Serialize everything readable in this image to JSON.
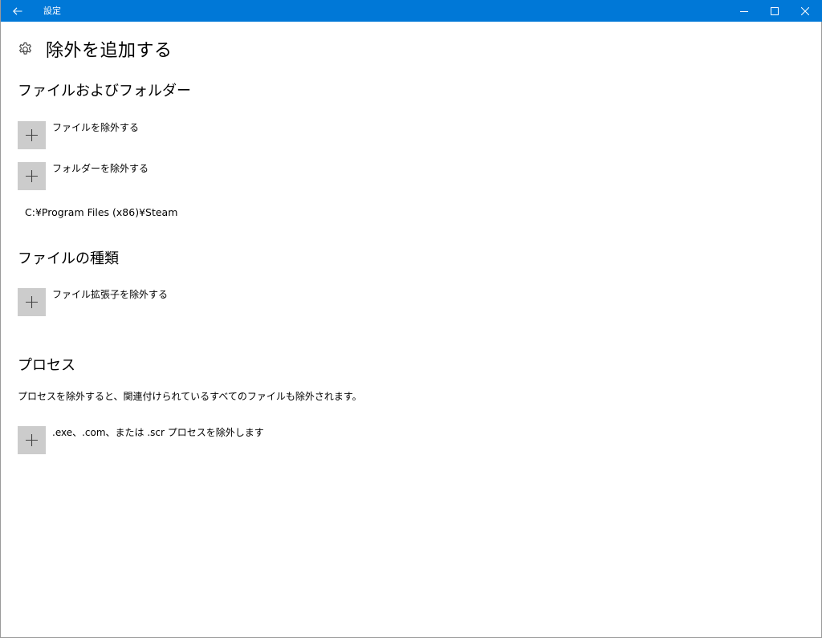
{
  "window": {
    "title": "設定"
  },
  "page": {
    "title": "除外を追加する"
  },
  "sections": {
    "files_folders": {
      "title": "ファイルおよびフォルダー",
      "add_file_label": "ファイルを除外する",
      "add_folder_label": "フォルダーを除外する",
      "excluded_items": [
        "C:¥Program Files (x86)¥Steam"
      ]
    },
    "file_types": {
      "title": "ファイルの種類",
      "add_extension_label": "ファイル拡張子を除外する"
    },
    "processes": {
      "title": "プロセス",
      "description": "プロセスを除外すると、関連付けられているすべてのファイルも除外されます。",
      "add_process_label": ".exe、.com、または .scr プロセスを除外します"
    }
  },
  "colors": {
    "titlebar": "#0078d7",
    "add_button": "#cccccc"
  },
  "icons": {
    "back": "back-arrow-icon",
    "settings": "gear-icon",
    "add": "plus-icon",
    "minimize": "minimize-icon",
    "maximize": "maximize-icon",
    "close": "close-icon"
  }
}
